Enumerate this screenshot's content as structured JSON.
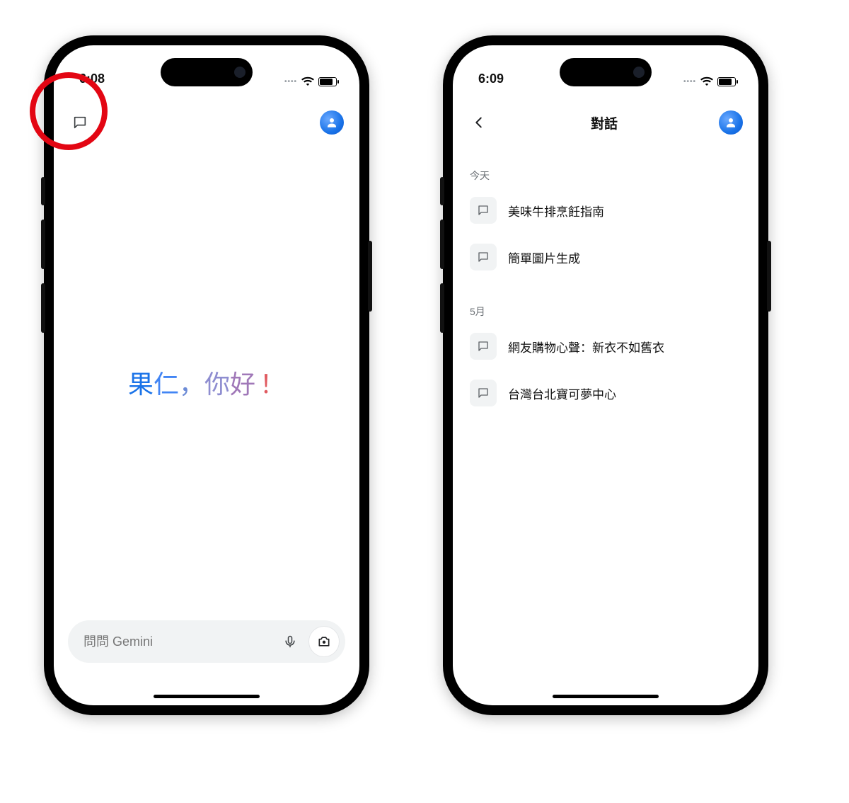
{
  "left": {
    "status_time": "6:08",
    "greeting_chars": [
      "果",
      "仁",
      "，",
      "你",
      "好",
      "！"
    ],
    "input_placeholder": "問問 Gemini"
  },
  "right": {
    "status_time": "6:09",
    "header_title": "對話",
    "sections": [
      {
        "label": "今天",
        "items": [
          "美味牛排烹飪指南",
          "簡單圖片生成"
        ]
      },
      {
        "label": "5月",
        "items": [
          "網友購物心聲：新衣不如舊衣",
          "台灣台北寶可夢中心"
        ]
      }
    ]
  },
  "annotation": {
    "kind": "red-circle-highlight",
    "target": "left.app-header.conversations-icon"
  }
}
